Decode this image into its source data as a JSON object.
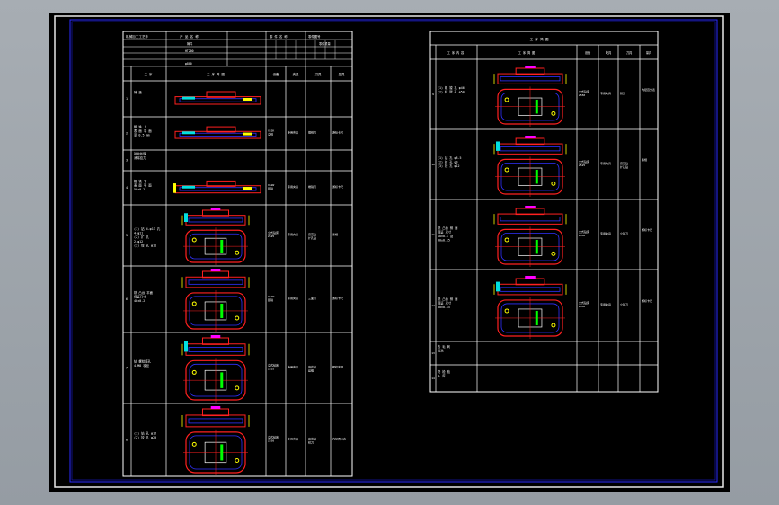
{
  "left_sheet": {
    "header": {
      "c1": "机械加工工艺卡",
      "c2": "产  品  名  称",
      "c3": "零 件 名 称",
      "c4": "零件图号",
      "r2c2": "铸件",
      "r2c4": "零件重量",
      "r3c2": "HT200",
      "r4c2": "φ800"
    },
    "col_headers": [
      "工  序",
      "工  序  简  图",
      "设备",
      "夹具",
      "刀具",
      "量具"
    ],
    "rows": [
      {
        "no": "1",
        "desc": "铸  造",
        "eq": "",
        "fix": "",
        "tool": "",
        "gauge": ""
      },
      {
        "no": "2",
        "desc": "粗 铣 上\n表 面 平 面\n至 0.5 mm",
        "eq": "X52K\n立铣",
        "fix": "专用夹具",
        "tool": "端铣刀",
        "gauge": "游标卡尺"
      },
      {
        "no": "3",
        "desc": "时效处理\n消除应力",
        "eq": "",
        "fix": "",
        "tool": "",
        "gauge": ""
      },
      {
        "no": "4",
        "desc": "粗 铣 下\n表 面 平 面\n50±0.2",
        "eq": "X62W\n卧铣",
        "fix": "专用夹具",
        "tool": "端铣刀",
        "gauge": "游标卡尺"
      },
      {
        "no": "5",
        "desc": "(1) 钻 4-φ13 孔\n4-φ11\n(2) 扩 孔\n2-φ12\n(3) 铰 孔 φ11",
        "eq": "立式钻床\nZ525",
        "fix": "专用夹具",
        "tool": "麻花钻\n扩孔钻",
        "gauge": "塞规"
      },
      {
        "no": "6",
        "desc": "铣 凸台 平面\n保证尺寸\n40±0.2",
        "eq": "X62W\n卧铣",
        "fix": "专用夹具",
        "tool": "三面刃",
        "gauge": "游标卡尺"
      },
      {
        "no": "7",
        "desc": "钻 螺纹底孔\n4-M8 攻丝",
        "eq": "立式钻床\nZ525",
        "fix": "专用夹具",
        "tool": "麻花钻\n丝锥",
        "gauge": "螺纹塞规"
      },
      {
        "no": "8",
        "desc": "(1) 钻 孔 φ16\n(2) 铰 孔 φ20",
        "eq": "立式钻床\nZ550",
        "fix": "专用夹具",
        "tool": "麻花钻\n铰刀",
        "gauge": "内径百分表"
      }
    ]
  },
  "right_sheet": {
    "header": {
      "title": "工  序  简  图",
      "col_headers": [
        "工 序 内 容",
        "工  序  简  图",
        "设备",
        "夹具",
        "刀具",
        "量具"
      ]
    },
    "rows": [
      {
        "no": "9",
        "desc": "(1) 粗 镗 孔 φ46\n(2) 精 镗 孔 φ50",
        "eq": "立式钻床\nZ550",
        "fix": "专用夹具",
        "tool": "镗刀",
        "gauge": "内径百分表"
      },
      {
        "no": "10",
        "desc": "(1) 钻 孔 φ8.5\n(2) 扩 孔 φ9\n(3) 铰 孔 φ12",
        "eq": "立式钻床\nZ525",
        "fix": "专用夹具",
        "tool": "麻花钻\n扩孔钻",
        "gauge": "塞规"
      },
      {
        "no": "11",
        "desc": "铣 凸台 侧 面\n保证 尺寸\n18±0.1 及\n30±0.15",
        "eq": "立式钻床\nZ550",
        "fix": "专用夹具",
        "tool": "立铣刀",
        "gauge": "游标卡尺"
      },
      {
        "no": "12",
        "desc": "铣 凸台 侧 面\n保证 尺寸\n30±0.15",
        "eq": "立式钻床\nZ550",
        "fix": "专用夹具",
        "tool": "立铣刀",
        "gauge": "游标卡尺"
      },
      {
        "no": "13",
        "desc": "去 毛 刺\n清洗",
        "eq": "",
        "fix": "",
        "tool": "",
        "gauge": ""
      },
      {
        "no": "14",
        "desc": "终 检 验\n入 库",
        "eq": "",
        "fix": "",
        "tool": "",
        "gauge": ""
      }
    ]
  }
}
